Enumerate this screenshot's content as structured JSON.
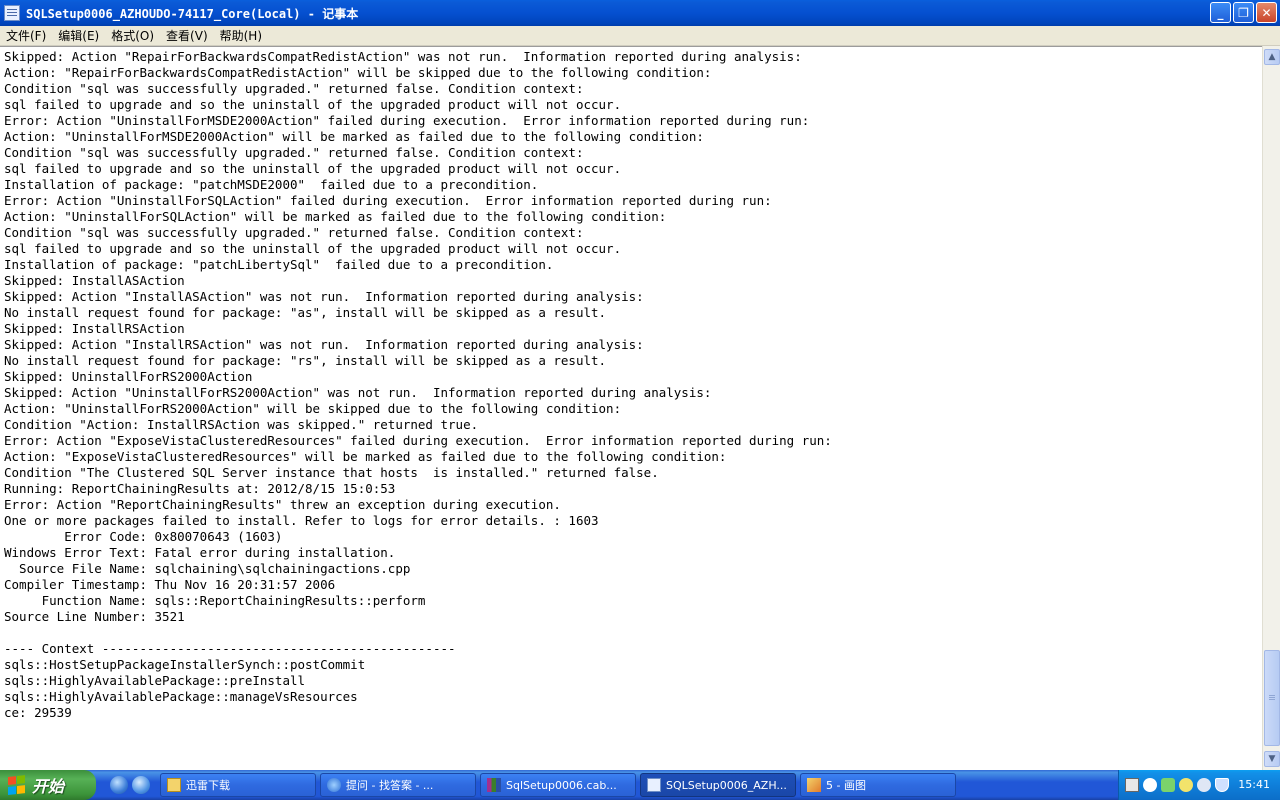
{
  "window": {
    "title": "SQLSetup0006_AZHOUDO-74117_Core(Local) - 记事本",
    "buttons": {
      "minimize": "_",
      "maximize": "❐",
      "close": "✕"
    }
  },
  "menu": {
    "file": "文件(F)",
    "edit": "编辑(E)",
    "format": "格式(O)",
    "view": "查看(V)",
    "help": "帮助(H)"
  },
  "document": {
    "text": "Skipped: Action \"RepairForBackwardsCompatRedistAction\" was not run.  Information reported during analysis:\nAction: \"RepairForBackwardsCompatRedistAction\" will be skipped due to the following condition:\nCondition \"sql was successfully upgraded.\" returned false. Condition context:\nsql failed to upgrade and so the uninstall of the upgraded product will not occur.\nError: Action \"UninstallForMSDE2000Action\" failed during execution.  Error information reported during run:\nAction: \"UninstallForMSDE2000Action\" will be marked as failed due to the following condition:\nCondition \"sql was successfully upgraded.\" returned false. Condition context:\nsql failed to upgrade and so the uninstall of the upgraded product will not occur.\nInstallation of package: \"patchMSDE2000\"  failed due to a precondition.\nError: Action \"UninstallForSQLAction\" failed during execution.  Error information reported during run:\nAction: \"UninstallForSQLAction\" will be marked as failed due to the following condition:\nCondition \"sql was successfully upgraded.\" returned false. Condition context:\nsql failed to upgrade and so the uninstall of the upgraded product will not occur.\nInstallation of package: \"patchLibertySql\"  failed due to a precondition.\nSkipped: InstallASAction\nSkipped: Action \"InstallASAction\" was not run.  Information reported during analysis:\nNo install request found for package: \"as\", install will be skipped as a result.\nSkipped: InstallRSAction\nSkipped: Action \"InstallRSAction\" was not run.  Information reported during analysis:\nNo install request found for package: \"rs\", install will be skipped as a result.\nSkipped: UninstallForRS2000Action\nSkipped: Action \"UninstallForRS2000Action\" was not run.  Information reported during analysis:\nAction: \"UninstallForRS2000Action\" will be skipped due to the following condition:\nCondition \"Action: InstallRSAction was skipped.\" returned true.\nError: Action \"ExposeVistaClusteredResources\" failed during execution.  Error information reported during run:\nAction: \"ExposeVistaClusteredResources\" will be marked as failed due to the following condition:\nCondition \"The Clustered SQL Server instance that hosts  is installed.\" returned false.\nRunning: ReportChainingResults at: 2012/8/15 15:0:53\nError: Action \"ReportChainingResults\" threw an exception during execution.\nOne or more packages failed to install. Refer to logs for error details. : 1603\n        Error Code: 0x80070643 (1603)\nWindows Error Text: Fatal error during installation.\n  Source File Name: sqlchaining\\sqlchainingactions.cpp\nCompiler Timestamp: Thu Nov 16 20:31:57 2006\n     Function Name: sqls::ReportChainingResults::perform\nSource Line Number: 3521\n\n---- Context -----------------------------------------------\nsqls::HostSetupPackageInstallerSynch::postCommit\nsqls::HighlyAvailablePackage::preInstall\nsqls::HighlyAvailablePackage::manageVsResources\nce: 29539"
  },
  "scrollbar": {
    "up_arrow": "▲",
    "down_arrow": "▼",
    "position_fraction": 0.86
  },
  "taskbar": {
    "start_label": "开始",
    "tasks": [
      {
        "label": "迅雷下载",
        "icon": "folder-icon"
      },
      {
        "label": "提问 - 找答案 - ...",
        "icon": "ie-icon"
      },
      {
        "label": "SqlSetup0006.cab...",
        "icon": "winrar-icon"
      },
      {
        "label": "SQLSetup0006_AZH...",
        "icon": "notepad-icon",
        "active": true
      },
      {
        "label": "5 - 画图",
        "icon": "paint-icon"
      }
    ],
    "clock": "15:41"
  },
  "colors": {
    "titlebar": "#0550d0",
    "menubar": "#ece9d8",
    "taskbar": "#2157d7",
    "start": "#3c943a",
    "tray": "#0f7fda"
  }
}
